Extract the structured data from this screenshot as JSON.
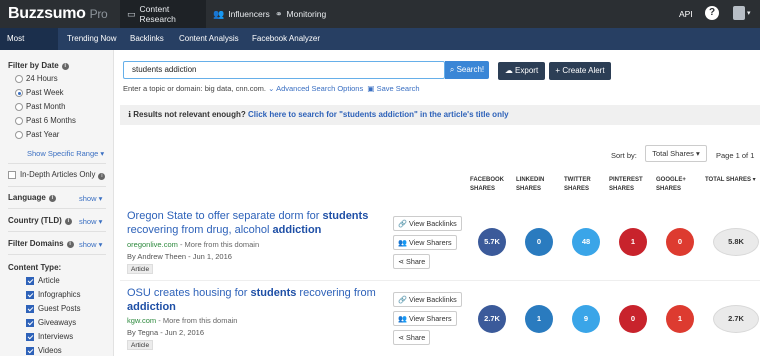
{
  "app": {
    "logo": "Buzzsumo",
    "logo_suffix": "Pro"
  },
  "topnav": [
    {
      "label": "Content Research",
      "icon": "monitor-icon"
    },
    {
      "label": "Influencers",
      "icon": "users-icon"
    },
    {
      "label": "Monitoring",
      "icon": "binoculars-icon"
    }
  ],
  "top_right": {
    "api": "API",
    "help": "?"
  },
  "subnav": [
    "Most Shared",
    "Trending Now",
    "Backlinks",
    "Content Analysis",
    "Facebook Analyzer"
  ],
  "sidebar": {
    "filter_by_date": "Filter by Date",
    "date_options": [
      "24 Hours",
      "Past Week",
      "Past Month",
      "Past 6 Months",
      "Past Year"
    ],
    "selected_date": "Past Week",
    "specific_range": "Show Specific Range ▾",
    "in_depth": "In-Depth Articles Only",
    "language": "Language",
    "country": "Country (TLD)",
    "filter_domains": "Filter Domains",
    "show": "show ▾",
    "content_type": "Content Type:",
    "content_types": [
      "Article",
      "Infographics",
      "Guest Posts",
      "Giveaways",
      "Interviews",
      "Videos"
    ]
  },
  "search": {
    "value": "students addiction",
    "button": "Search!",
    "export": "Export",
    "create_alert": "+ Create Alert",
    "hint": "Enter a topic or domain: big data, cnn.com.",
    "advanced": "Advanced Search Options",
    "save": "Save Search"
  },
  "notice": {
    "prefix": "Results not relevant enough?",
    "link": "Click here to search for \"students addiction\" in the article's title only"
  },
  "sort": {
    "label": "Sort by:",
    "value": "Total Shares ▾",
    "page": "Page 1 of 1"
  },
  "columns": [
    "FACEBOOK\nSHARES",
    "LINKEDIN\nSHARES",
    "TWITTER\nSHARES",
    "PINTEREST\nSHARES",
    "GOOGLE+\nSHARES",
    "TOTAL SHARES ▾"
  ],
  "colors": {
    "facebook": "#3b5a9a",
    "linkedin": "#2a7bbf",
    "twitter": "#3aa5e8",
    "pinterest": "#c8232c",
    "googleplus": "#dd3b30"
  },
  "actions": {
    "backlinks": "View Backlinks",
    "sharers": "View Sharers",
    "share": "Share"
  },
  "results": [
    {
      "title_pre": "Oregon State to offer separate dorm for ",
      "title_b1": "students",
      "title_mid": " recovering from drug, alcohol ",
      "title_b2": "addiction",
      "title_post": "",
      "domain": "oregonlive.com",
      "more": " - More from this domain",
      "author": "By Andrew Theen - Jun 1, 2016",
      "type": "Article",
      "facebook": "5.7K",
      "linkedin": "0",
      "twitter": "48",
      "pinterest": "1",
      "googleplus": "0",
      "total": "5.8K"
    },
    {
      "title_pre": "OSU creates housing for ",
      "title_b1": "students",
      "title_mid": " recovering from ",
      "title_b2": "addiction",
      "title_post": "",
      "domain": "kgw.com",
      "more": " - More from this domain",
      "author": "By Tegna - Jun 2, 2016",
      "type": "Article",
      "facebook": "2.7K",
      "linkedin": "1",
      "twitter": "9",
      "pinterest": "0",
      "googleplus": "1",
      "total": "2.7K"
    }
  ]
}
